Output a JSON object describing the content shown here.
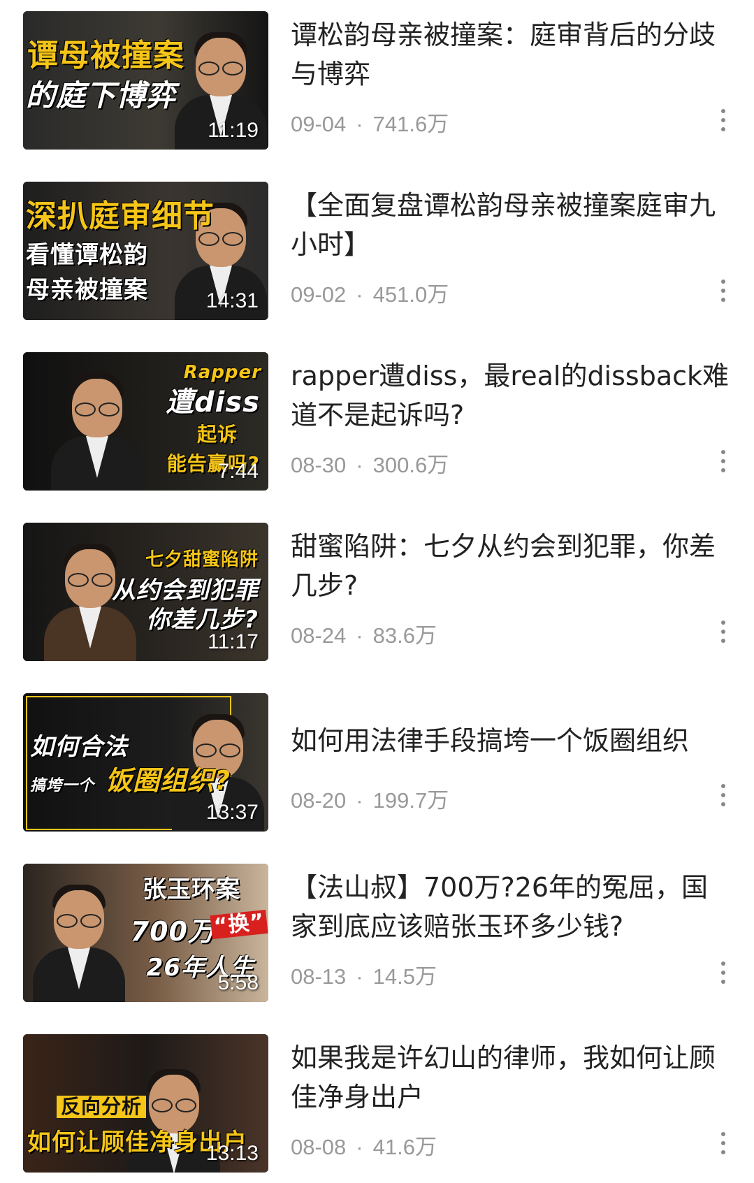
{
  "videos": [
    {
      "title": "谭松韵母亲被撞案：庭审背后的分歧与博弈",
      "date": "09-04",
      "views": "741.6万",
      "duration": "11:19",
      "overlay": [
        "谭母被撞案",
        "的庭下博弈"
      ]
    },
    {
      "title": "【全面复盘谭松韵母亲被撞案庭审九小时】",
      "date": "09-02",
      "views": "451.0万",
      "duration": "14:31",
      "overlay": [
        "深扒庭审细节",
        "看懂谭松韵",
        "母亲被撞案"
      ]
    },
    {
      "title": "rapper遭diss，最real的dissback难道不是起诉吗?",
      "date": "08-30",
      "views": "300.6万",
      "duration": "7:44",
      "overlay": [
        "Rapper",
        "遭diss",
        "起诉",
        "能告赢吗?"
      ]
    },
    {
      "title": "甜蜜陷阱：七夕从约会到犯罪，你差几步?",
      "date": "08-24",
      "views": "83.6万",
      "duration": "11:17",
      "overlay": [
        "七夕甜蜜陷阱",
        "从约会到犯罪",
        "你差几步?"
      ]
    },
    {
      "title": "如何用法律手段搞垮一个饭圈组织",
      "date": "08-20",
      "views": "199.7万",
      "duration": "13:37",
      "overlay": [
        "如何合法",
        "搞垮一个",
        "饭圈组织?"
      ]
    },
    {
      "title": "【法山叔】700万?26年的冤屈，国家到底应该赔张玉环多少钱?",
      "date": "08-13",
      "views": "14.5万",
      "duration": "5:58",
      "overlay": [
        "张玉环案",
        "700万",
        "“换”",
        "26年人生"
      ]
    },
    {
      "title": "如果我是许幻山的律师，我如何让顾佳净身出户",
      "date": "08-08",
      "views": "41.6万",
      "duration": "13:13",
      "overlay": [
        "反向分析",
        "如何让顾佳净身出户"
      ]
    }
  ],
  "meta_separator": "·",
  "colors": {
    "title_text": "#222222",
    "meta_text": "#999999",
    "overlay_yellow": "#f5c518",
    "badge_red": "#d8201f"
  },
  "icons": {
    "more": "more-vertical-icon"
  }
}
